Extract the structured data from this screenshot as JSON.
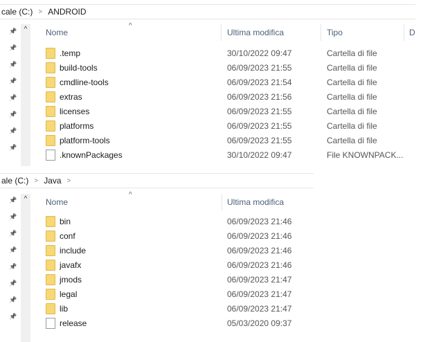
{
  "top": {
    "breadcrumb": [
      "cale (C:)",
      "ANDROID"
    ],
    "headers": {
      "name": "Nome",
      "modified": "Ultima modifica",
      "type": "Tipo",
      "extra": "D"
    },
    "rows": [
      {
        "name": ".temp",
        "modified": "30/10/2022 09:47",
        "type": "Cartella di file",
        "kind": "folder"
      },
      {
        "name": "build-tools",
        "modified": "06/09/2023 21:55",
        "type": "Cartella di file",
        "kind": "folder"
      },
      {
        "name": "cmdline-tools",
        "modified": "06/09/2023 21:54",
        "type": "Cartella di file",
        "kind": "folder"
      },
      {
        "name": "extras",
        "modified": "06/09/2023 21:56",
        "type": "Cartella di file",
        "kind": "folder"
      },
      {
        "name": "licenses",
        "modified": "06/09/2023 21:55",
        "type": "Cartella di file",
        "kind": "folder"
      },
      {
        "name": "platforms",
        "modified": "06/09/2023 21:55",
        "type": "Cartella di file",
        "kind": "folder"
      },
      {
        "name": "platform-tools",
        "modified": "06/09/2023 21:55",
        "type": "Cartella di file",
        "kind": "folder"
      },
      {
        "name": ".knownPackages",
        "modified": "30/10/2022 09:47",
        "type": "File KNOWNPACK...",
        "kind": "file"
      }
    ]
  },
  "bottom": {
    "breadcrumb": [
      "ale (C:)",
      "Java"
    ],
    "headers": {
      "name": "Nome",
      "modified": "Ultima modifica"
    },
    "rows": [
      {
        "name": "bin",
        "modified": "06/09/2023 21:46",
        "kind": "folder"
      },
      {
        "name": "conf",
        "modified": "06/09/2023 21:46",
        "kind": "folder"
      },
      {
        "name": "include",
        "modified": "06/09/2023 21:46",
        "kind": "folder"
      },
      {
        "name": "javafx",
        "modified": "06/09/2023 21:46",
        "kind": "folder"
      },
      {
        "name": "jmods",
        "modified": "06/09/2023 21:47",
        "kind": "folder"
      },
      {
        "name": "legal",
        "modified": "06/09/2023 21:47",
        "kind": "folder"
      },
      {
        "name": "lib",
        "modified": "06/09/2023 21:47",
        "kind": "folder"
      },
      {
        "name": "release",
        "modified": "05/03/2020 09:37",
        "kind": "file"
      }
    ]
  }
}
